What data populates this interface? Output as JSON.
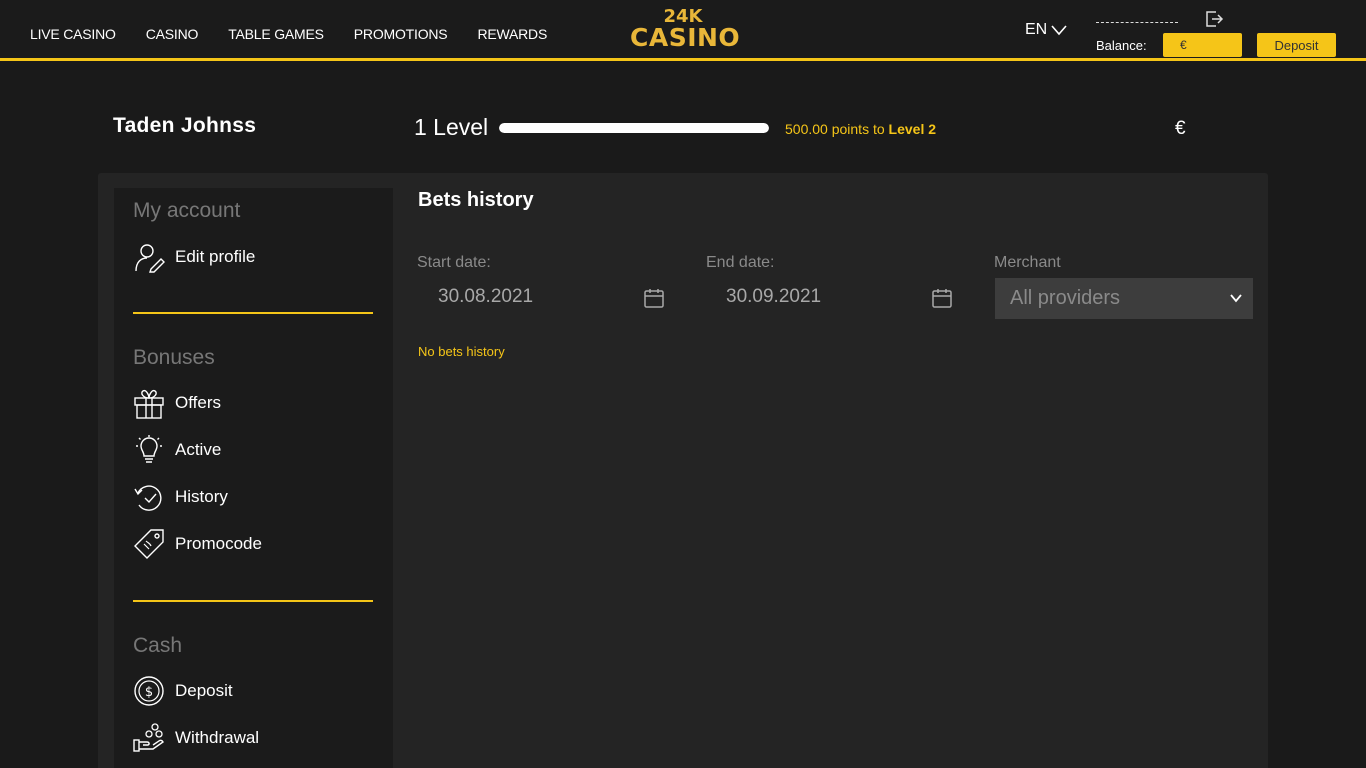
{
  "nav": {
    "items": [
      "LIVE CASINO",
      "CASINO",
      "TABLE GAMES",
      "PROMOTIONS",
      "REWARDS"
    ]
  },
  "logo": {
    "top": "24K",
    "bottom": "CASINO"
  },
  "header": {
    "lang": "EN",
    "balance_label": "Balance:",
    "balance_value": "€",
    "deposit_label": "Deposit"
  },
  "profile": {
    "username": "Taden Johnss",
    "level_text": "1 Level",
    "level_progress": 1.0,
    "points_prefix": "500.00 points to ",
    "points_level": "Level 2",
    "currency": "€"
  },
  "sidebar": {
    "sections": [
      {
        "title": "My account",
        "items": [
          {
            "label": "Edit profile",
            "icon": "edit-profile-icon"
          }
        ]
      },
      {
        "title": "Bonuses",
        "items": [
          {
            "label": "Offers",
            "icon": "gift-icon"
          },
          {
            "label": "Active",
            "icon": "lightbulb-icon"
          },
          {
            "label": "History",
            "icon": "history-icon"
          },
          {
            "label": "Promocode",
            "icon": "tag-icon"
          }
        ]
      },
      {
        "title": "Cash",
        "items": [
          {
            "label": "Deposit",
            "icon": "dollar-coin-icon"
          },
          {
            "label": "Withdrawal",
            "icon": "withdrawal-hand-icon"
          }
        ]
      }
    ]
  },
  "content": {
    "title": "Bets history",
    "start_label": "Start date:",
    "start_value": "30.08.2021",
    "end_label": "End date:",
    "end_value": "30.09.2021",
    "merchant_label": "Merchant",
    "merchant_value": "All providers",
    "empty_text": "No bets history"
  },
  "colors": {
    "accent": "#f5c518",
    "logo": "#e9b739",
    "panel": "#242424",
    "sidebar": "#1b1b1b"
  }
}
